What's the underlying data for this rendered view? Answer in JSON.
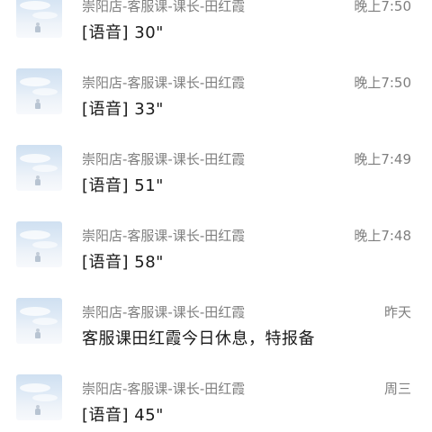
{
  "conversations": [
    {
      "name": "崇阳店-客服课-课长-田红霞",
      "time": "晚上7:50",
      "message": "[语音] 30\""
    },
    {
      "name": "崇阳店-客服课-课长-田红霞",
      "time": "晚上7:50",
      "message": "[语音] 33\""
    },
    {
      "name": "崇阳店-客服课-课长-田红霞",
      "time": "晚上7:49",
      "message": "[语音] 51\""
    },
    {
      "name": "崇阳店-客服课-课长-田红霞",
      "time": "晚上7:48",
      "message": "[语音] 58\""
    },
    {
      "name": "崇阳店-客服课-课长-田红霞",
      "time": "昨天",
      "message": "客服课田红霞今日休息，特报备"
    },
    {
      "name": "崇阳店-客服课-课长-田红霞",
      "time": "周三",
      "message": "[语音] 45\""
    }
  ]
}
